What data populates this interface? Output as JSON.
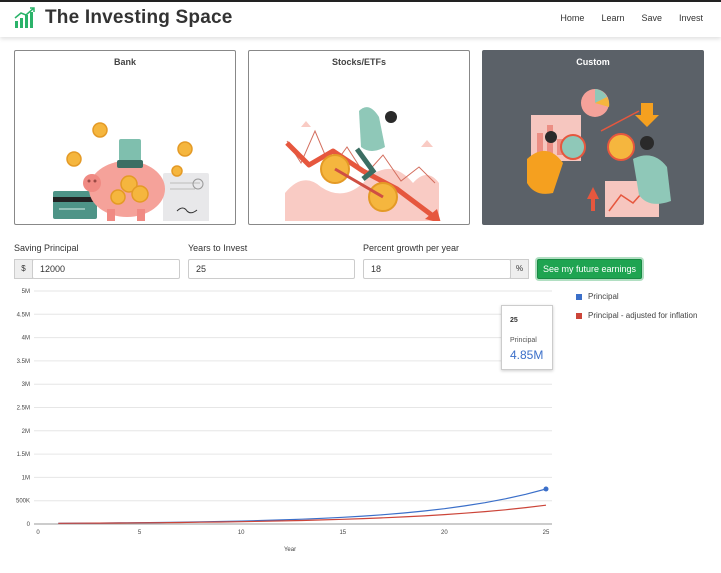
{
  "app": {
    "title": "The Investing Space"
  },
  "nav": {
    "items": [
      "Home",
      "Learn",
      "Save",
      "Invest"
    ]
  },
  "cards": [
    {
      "title": "Bank"
    },
    {
      "title": "Stocks/ETFs"
    },
    {
      "title": "Custom"
    }
  ],
  "form": {
    "principal_label": "Saving Principal",
    "currency_symbol": "$",
    "principal_value": "12000",
    "years_label": "Years to Invest",
    "years_value": "25",
    "growth_label": "Percent growth per year",
    "growth_value": "18",
    "percent_symbol": "%",
    "submit_label": "See my future earnings"
  },
  "colors": {
    "accent": "#1fa451",
    "principal": "#3b6fc9",
    "inflation": "#cc4539",
    "custom_card": "#5b6168"
  },
  "chart_data": {
    "type": "line",
    "xlabel": "Year",
    "ylabel": "",
    "x": [
      1,
      2,
      3,
      4,
      5,
      6,
      7,
      8,
      9,
      10,
      11,
      12,
      13,
      14,
      15,
      16,
      17,
      18,
      19,
      20,
      21,
      22,
      23,
      24,
      25
    ],
    "xticks": [
      0,
      5,
      10,
      15,
      20,
      25
    ],
    "xlim": [
      0,
      25
    ],
    "ylim": [
      0,
      5000000
    ],
    "yticks": [
      0,
      500000,
      1000000,
      1500000,
      2000000,
      2500000,
      3000000,
      3500000,
      4000000,
      4500000,
      5000000
    ],
    "ytick_labels": [
      "0",
      "500K",
      "1M",
      "1.5M",
      "2M",
      "2.5M",
      "3M",
      "3.5M",
      "4M",
      "4.5M",
      "5M"
    ],
    "series": [
      {
        "name": "Principal",
        "values": [
          14160,
          16709,
          19716,
          23265,
          27453,
          32394,
          38225,
          45105,
          53224,
          62804,
          74109,
          87448,
          103189,
          121763,
          143680,
          169542,
          200060,
          236070,
          278563,
          328704,
          387871,
          457688,
          540072,
          637284,
          751995
        ]
      },
      {
        "name": "Principal - adjusted for inflation",
        "values": [
          14160,
          16281,
          18720,
          21524,
          24749,
          28456,
          32718,
          37618,
          43253,
          49731,
          57180,
          65744,
          75591,
          86912,
          99930,
          114898,
          132107,
          151893,
          174644,
          200801,
          230877,
          265457,
          305217,
          350931,
          403494
        ]
      }
    ],
    "grid": true,
    "legend": "right",
    "tooltip": {
      "title": "25",
      "label": "Principal",
      "value": "4.85M"
    }
  }
}
